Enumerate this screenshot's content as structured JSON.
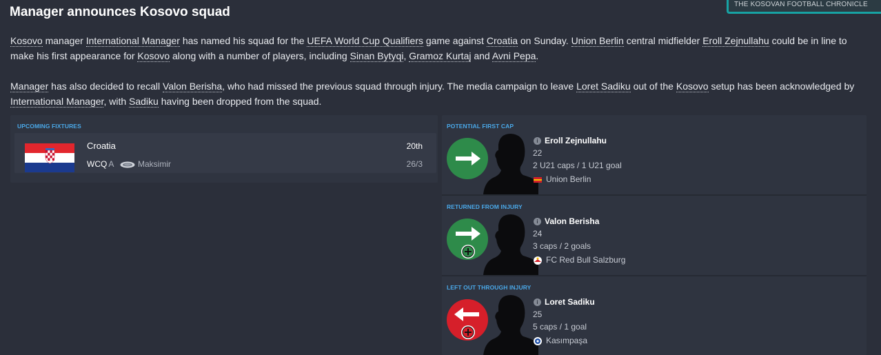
{
  "header": {
    "title": "Manager announces Kosovo squad",
    "source": "THE KOSOVAN FOOTBALL CHRONICLE"
  },
  "article": {
    "p1": [
      {
        "t": "Kosovo",
        "link": true
      },
      {
        "t": " manager ",
        "link": false
      },
      {
        "t": "International Manager",
        "link": true
      },
      {
        "t": " has named his squad for the ",
        "link": false
      },
      {
        "t": "UEFA World Cup Qualifiers",
        "link": true
      },
      {
        "t": " game against ",
        "link": false
      },
      {
        "t": "Croatia",
        "link": true
      },
      {
        "t": " on Sunday. ",
        "link": false
      },
      {
        "t": "Union Berlin",
        "link": true
      },
      {
        "t": " central midfielder ",
        "link": false
      },
      {
        "t": "Eroll Zejnullahu",
        "link": true
      },
      {
        "t": " could be in line to make his first appearance for ",
        "link": false
      },
      {
        "t": "Kosovo",
        "link": true
      },
      {
        "t": " along with a number of players, including ",
        "link": false
      },
      {
        "t": "Sinan Bytyqi",
        "link": true
      },
      {
        "t": ", ",
        "link": false
      },
      {
        "t": "Gramoz Kurtaj",
        "link": true
      },
      {
        "t": " and ",
        "link": false
      },
      {
        "t": "Avni Pepa",
        "link": true
      },
      {
        "t": ".",
        "link": false
      }
    ],
    "p2": [
      {
        "t": "Manager",
        "link": true
      },
      {
        "t": " has also decided to recall ",
        "link": false
      },
      {
        "t": "Valon Berisha",
        "link": true
      },
      {
        "t": ", who had missed the previous squad through injury. The media campaign to leave ",
        "link": false
      },
      {
        "t": "Loret Sadiku",
        "link": true
      },
      {
        "t": " out of the ",
        "link": false
      },
      {
        "t": "Kosovo",
        "link": true
      },
      {
        "t": " setup has been acknowledged by ",
        "link": false
      },
      {
        "t": "International Manager",
        "link": true
      },
      {
        "t": ", with ",
        "link": false
      },
      {
        "t": "Sadiku",
        "link": true
      },
      {
        "t": " having been dropped from the squad.",
        "link": false
      }
    ]
  },
  "fixtures": {
    "label": "UPCOMING FIXTURES",
    "items": [
      {
        "team": "Croatia",
        "comp": "WCQ",
        "venue_type": "A",
        "stadium": "Maksimir",
        "date1": "20th",
        "date2": "26/3"
      }
    ]
  },
  "players": [
    {
      "label": "POTENTIAL FIRST CAP",
      "name": "Eroll Zejnullahu",
      "age": "22",
      "caps": "2 U21 caps / 1 U21 goal",
      "club": "Union Berlin",
      "status": "in",
      "badge": false,
      "club_icon": "union-berlin-crest-icon"
    },
    {
      "label": "RETURNED FROM INJURY",
      "name": "Valon Berisha",
      "age": "24",
      "caps": "3 caps / 2 goals",
      "club": "FC Red Bull Salzburg",
      "status": "in",
      "badge": true,
      "club_icon": "salzburg-crest-icon"
    },
    {
      "label": "LEFT OUT THROUGH INJURY",
      "name": "Loret Sadiku",
      "age": "25",
      "caps": "5 caps / 1 goal",
      "club": "Kasımpaşa",
      "status": "out",
      "badge": true,
      "club_icon": "kasimpasa-crest-icon"
    }
  ],
  "colors": {
    "in": "#2e8b4a",
    "out": "#d61f2a",
    "accent": "#17a3a4",
    "section_label": "#4aa8e8"
  }
}
